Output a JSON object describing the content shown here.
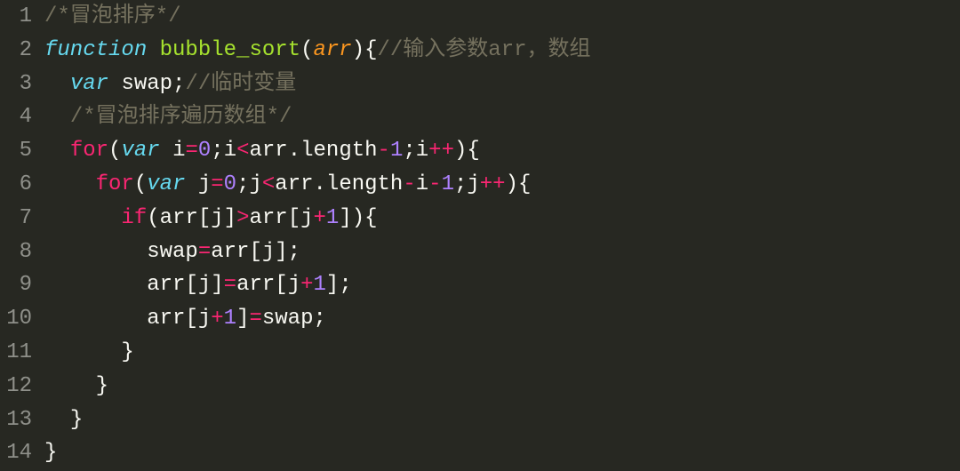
{
  "editor": {
    "lineNumbers": [
      "1",
      "2",
      "3",
      "4",
      "5",
      "6",
      "7",
      "8",
      "9",
      "10",
      "11",
      "12",
      "13",
      "14"
    ],
    "tokens": [
      [
        {
          "t": "/*冒泡排序*/",
          "c": "tok-comment"
        }
      ],
      [
        {
          "t": "function",
          "c": "tok-storage"
        },
        {
          "t": " ",
          "c": "tok-ident"
        },
        {
          "t": "bubble_sort",
          "c": "tok-funcname"
        },
        {
          "t": "(",
          "c": "tok-punct"
        },
        {
          "t": "arr",
          "c": "tok-param"
        },
        {
          "t": ")",
          "c": "tok-punct"
        },
        {
          "t": "{",
          "c": "tok-punct"
        },
        {
          "t": "//输入参数arr，数组",
          "c": "tok-comment"
        }
      ],
      [
        {
          "t": "  ",
          "c": "tok-ident"
        },
        {
          "t": "var",
          "c": "tok-storage"
        },
        {
          "t": " ",
          "c": "tok-ident"
        },
        {
          "t": "swap",
          "c": "tok-ident"
        },
        {
          "t": ";",
          "c": "tok-punct"
        },
        {
          "t": "//临时变量",
          "c": "tok-comment"
        }
      ],
      [
        {
          "t": "  ",
          "c": "tok-ident"
        },
        {
          "t": "/*冒泡排序遍历数组*/",
          "c": "tok-comment"
        }
      ],
      [
        {
          "t": "  ",
          "c": "tok-ident"
        },
        {
          "t": "for",
          "c": "tok-keyword-n"
        },
        {
          "t": "(",
          "c": "tok-punct"
        },
        {
          "t": "var",
          "c": "tok-storage"
        },
        {
          "t": " ",
          "c": "tok-ident"
        },
        {
          "t": "i",
          "c": "tok-ident"
        },
        {
          "t": "=",
          "c": "tok-op"
        },
        {
          "t": "0",
          "c": "tok-number"
        },
        {
          "t": ";",
          "c": "tok-punct"
        },
        {
          "t": "i",
          "c": "tok-ident"
        },
        {
          "t": "<",
          "c": "tok-op"
        },
        {
          "t": "arr",
          "c": "tok-ident"
        },
        {
          "t": ".",
          "c": "tok-punct"
        },
        {
          "t": "length",
          "c": "tok-ident"
        },
        {
          "t": "-",
          "c": "tok-op"
        },
        {
          "t": "1",
          "c": "tok-number"
        },
        {
          "t": ";",
          "c": "tok-punct"
        },
        {
          "t": "i",
          "c": "tok-ident"
        },
        {
          "t": "++",
          "c": "tok-op"
        },
        {
          "t": ")",
          "c": "tok-punct"
        },
        {
          "t": "{",
          "c": "tok-punct"
        }
      ],
      [
        {
          "t": "    ",
          "c": "tok-ident"
        },
        {
          "t": "for",
          "c": "tok-keyword-n"
        },
        {
          "t": "(",
          "c": "tok-punct"
        },
        {
          "t": "var",
          "c": "tok-storage"
        },
        {
          "t": " ",
          "c": "tok-ident"
        },
        {
          "t": "j",
          "c": "tok-ident"
        },
        {
          "t": "=",
          "c": "tok-op"
        },
        {
          "t": "0",
          "c": "tok-number"
        },
        {
          "t": ";",
          "c": "tok-punct"
        },
        {
          "t": "j",
          "c": "tok-ident"
        },
        {
          "t": "<",
          "c": "tok-op"
        },
        {
          "t": "arr",
          "c": "tok-ident"
        },
        {
          "t": ".",
          "c": "tok-punct"
        },
        {
          "t": "length",
          "c": "tok-ident"
        },
        {
          "t": "-",
          "c": "tok-op"
        },
        {
          "t": "i",
          "c": "tok-ident"
        },
        {
          "t": "-",
          "c": "tok-op"
        },
        {
          "t": "1",
          "c": "tok-number"
        },
        {
          "t": ";",
          "c": "tok-punct"
        },
        {
          "t": "j",
          "c": "tok-ident"
        },
        {
          "t": "++",
          "c": "tok-op"
        },
        {
          "t": ")",
          "c": "tok-punct"
        },
        {
          "t": "{",
          "c": "tok-punct"
        }
      ],
      [
        {
          "t": "      ",
          "c": "tok-ident"
        },
        {
          "t": "if",
          "c": "tok-keyword-n"
        },
        {
          "t": "(",
          "c": "tok-punct"
        },
        {
          "t": "arr",
          "c": "tok-ident"
        },
        {
          "t": "[",
          "c": "tok-punct"
        },
        {
          "t": "j",
          "c": "tok-ident"
        },
        {
          "t": "]",
          "c": "tok-punct"
        },
        {
          "t": ">",
          "c": "tok-op"
        },
        {
          "t": "arr",
          "c": "tok-ident"
        },
        {
          "t": "[",
          "c": "tok-punct"
        },
        {
          "t": "j",
          "c": "tok-ident"
        },
        {
          "t": "+",
          "c": "tok-op"
        },
        {
          "t": "1",
          "c": "tok-number"
        },
        {
          "t": "]",
          "c": "tok-punct"
        },
        {
          "t": ")",
          "c": "tok-punct"
        },
        {
          "t": "{",
          "c": "tok-punct"
        }
      ],
      [
        {
          "t": "        ",
          "c": "tok-ident"
        },
        {
          "t": "swap",
          "c": "tok-ident"
        },
        {
          "t": "=",
          "c": "tok-op"
        },
        {
          "t": "arr",
          "c": "tok-ident"
        },
        {
          "t": "[",
          "c": "tok-punct"
        },
        {
          "t": "j",
          "c": "tok-ident"
        },
        {
          "t": "]",
          "c": "tok-punct"
        },
        {
          "t": ";",
          "c": "tok-punct"
        }
      ],
      [
        {
          "t": "        ",
          "c": "tok-ident"
        },
        {
          "t": "arr",
          "c": "tok-ident"
        },
        {
          "t": "[",
          "c": "tok-punct"
        },
        {
          "t": "j",
          "c": "tok-ident"
        },
        {
          "t": "]",
          "c": "tok-punct"
        },
        {
          "t": "=",
          "c": "tok-op"
        },
        {
          "t": "arr",
          "c": "tok-ident"
        },
        {
          "t": "[",
          "c": "tok-punct"
        },
        {
          "t": "j",
          "c": "tok-ident"
        },
        {
          "t": "+",
          "c": "tok-op"
        },
        {
          "t": "1",
          "c": "tok-number"
        },
        {
          "t": "]",
          "c": "tok-punct"
        },
        {
          "t": ";",
          "c": "tok-punct"
        }
      ],
      [
        {
          "t": "        ",
          "c": "tok-ident"
        },
        {
          "t": "arr",
          "c": "tok-ident"
        },
        {
          "t": "[",
          "c": "tok-punct"
        },
        {
          "t": "j",
          "c": "tok-ident"
        },
        {
          "t": "+",
          "c": "tok-op"
        },
        {
          "t": "1",
          "c": "tok-number"
        },
        {
          "t": "]",
          "c": "tok-punct"
        },
        {
          "t": "=",
          "c": "tok-op"
        },
        {
          "t": "swap",
          "c": "tok-ident"
        },
        {
          "t": ";",
          "c": "tok-punct"
        }
      ],
      [
        {
          "t": "      ",
          "c": "tok-ident"
        },
        {
          "t": "}",
          "c": "tok-punct"
        }
      ],
      [
        {
          "t": "    ",
          "c": "tok-ident"
        },
        {
          "t": "}",
          "c": "tok-punct"
        }
      ],
      [
        {
          "t": "  ",
          "c": "tok-ident"
        },
        {
          "t": "}",
          "c": "tok-punct"
        }
      ],
      [
        {
          "t": "}",
          "c": "tok-punct"
        }
      ]
    ]
  }
}
